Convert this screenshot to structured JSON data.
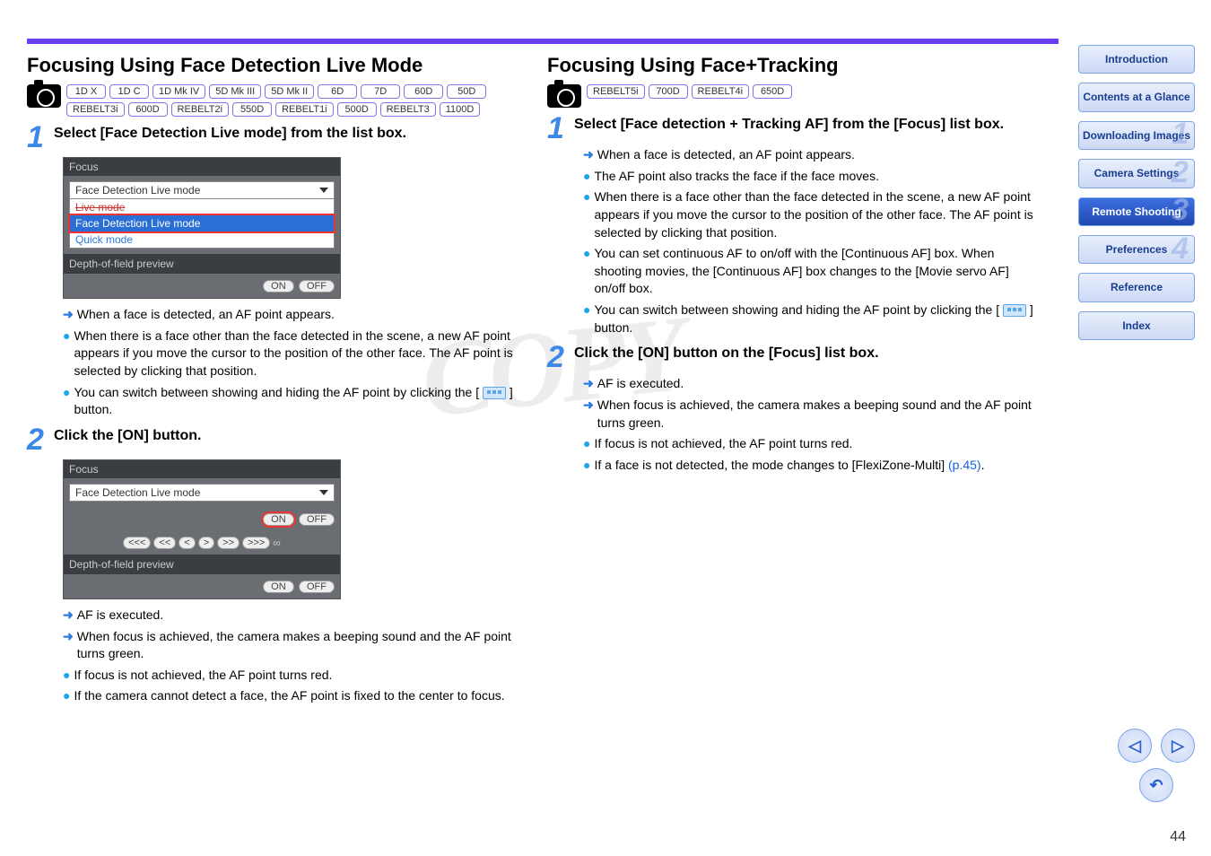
{
  "left": {
    "heading": "Focusing Using Face Detection Live Mode",
    "models": [
      "1D X",
      "1D C",
      "1D Mk IV",
      "5D Mk III",
      "5D Mk II",
      "6D",
      "7D",
      "60D",
      "50D",
      "REBELT3i",
      "600D",
      "REBELT2i",
      "550D",
      "REBELT1i",
      "500D",
      "REBELT3",
      "1100D"
    ],
    "step1": {
      "title": "Select [Face Detection Live mode] from the list box.",
      "panel_title": "Focus",
      "selected": "Face Detection Live mode",
      "opt_strike": "Live mode",
      "opt_sel": "Face Detection Live mode",
      "opt_quick": "Quick mode",
      "dof": "Depth-of-field preview",
      "on": "ON",
      "off": "OFF",
      "b1": "When a face is detected, an AF point appears.",
      "b2": "When there is a face other than the face detected in the scene, a new AF point appears if you move the cursor to the position of the other face. The AF point is selected by clicking that position.",
      "b3a": "You can switch between showing and hiding the AF point by clicking the [",
      "b3b": "] button."
    },
    "step2": {
      "title": "Click the [ON] button.",
      "panel_title": "Focus",
      "selected": "Face Detection Live mode",
      "on": "ON",
      "off": "OFF",
      "dof": "Depth-of-field preview",
      "b1": "AF is executed.",
      "b2": "When focus is achieved, the camera makes a beeping sound and the AF point turns green.",
      "b3": "If focus is not achieved, the AF point turns red.",
      "b4": "If the camera cannot detect a face, the AF point is fixed to the center to focus."
    }
  },
  "right": {
    "heading": "Focusing Using Face+Tracking",
    "models": [
      "REBELT5i",
      "700D",
      "REBELT4i",
      "650D"
    ],
    "step1": {
      "title": "Select [Face detection + Tracking AF] from the [Focus] list box.",
      "b1": "When a face is detected, an AF point appears.",
      "b2": "The AF point also tracks the face if the face moves.",
      "b3": "When there is a face other than the face detected in the scene, a new AF point appears if you move the cursor to the position of the other face. The AF point is selected by clicking that position.",
      "b4": "You can set continuous AF to on/off with the [Continuous AF] box. When shooting movies, the [Continuous AF] box changes to the [Movie servo AF] on/off box.",
      "b5a": "You can switch between showing and hiding the AF point by clicking the [",
      "b5b": "] button."
    },
    "step2": {
      "title": "Click the [ON] button on the [Focus] list box.",
      "b1": "AF is executed.",
      "b2": "When focus is achieved, the camera makes a beeping sound and the AF point turns green.",
      "b3": "If focus is not achieved, the AF point turns red.",
      "b4a": "If a face is not detected, the mode changes to [FlexiZone-Multi] ",
      "b4link": "(p.45)",
      "b4b": "."
    }
  },
  "sidebar": {
    "intro": "Introduction",
    "contents": "Contents at a Glance",
    "down": "Downloading Images",
    "cam": "Camera Settings",
    "remote": "Remote Shooting",
    "prefs": "Preferences",
    "ref": "Reference",
    "idx": "Index",
    "n1": "1",
    "n2": "2",
    "n3": "3",
    "n4": "4"
  },
  "watermark": "COPY",
  "page": "44"
}
